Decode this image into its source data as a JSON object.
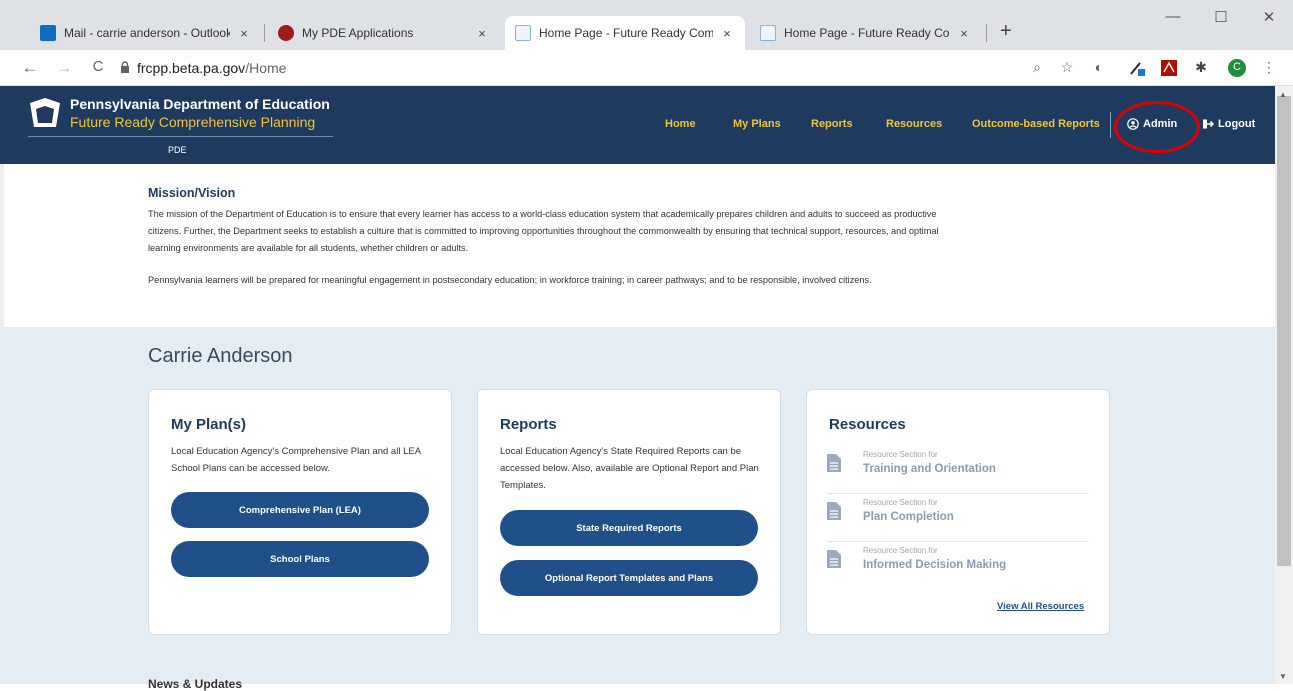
{
  "browser": {
    "tabs": [
      {
        "label": "Mail - carrie anderson - Outlook",
        "close": "×",
        "color": "#0f6cbd"
      },
      {
        "label": "My PDE Applications",
        "close": "×",
        "color": "#9b1c1c"
      },
      {
        "label": "Home Page - Future Ready Comp",
        "close": "×",
        "color": "#8ab4d8"
      },
      {
        "label": "Home Page - Future Ready Comp",
        "close": "×",
        "color": "#8ab4d8"
      }
    ],
    "new_tab": "+",
    "window_controls": {
      "minimize": "—",
      "maximize": "☐",
      "close": "✕"
    },
    "url_host": "frcpp.beta.pa.gov",
    "url_path": "/Home",
    "nav": {
      "back": "←",
      "forward": "→",
      "reload": "C"
    },
    "profile_initial": "C"
  },
  "header": {
    "org_name": "Pennsylvania Department of Education",
    "app_name": "Future Ready Comprehensive Planning",
    "sub_label": "PDE",
    "nav": [
      "Home",
      "My Plans",
      "Reports",
      "Resources",
      "Outcome-based Reports"
    ],
    "admin": "Admin",
    "logout": "Logout"
  },
  "mission": {
    "title": "Mission/Vision",
    "paragraph1": "The mission of the Department of Education is to ensure that every learner has access to a world-class education system that academically prepares children and adults to succeed as productive citizens. Further, the Department seeks to establish a culture that is committed to improving opportunities throughout the commonwealth by ensuring that technical support, resources, and optimal learning environments are available for all students, whether children or adults.",
    "paragraph2": "Pennsylvania learners will be prepared for meaningful engagement in postsecondary education; in workforce training; in career pathways; and to be responsible, involved citizens."
  },
  "user_name": "Carrie Anderson",
  "cards": {
    "plans": {
      "title": "My Plan(s)",
      "desc": "Local Education Agency's Comprehensive Plan and all LEA School Plans can be accessed below.",
      "button1": "Comprehensive Plan (LEA)",
      "button2": "School Plans"
    },
    "reports": {
      "title": "Reports",
      "desc": "Local Education Agency's State Required Reports can be accessed below. Also, available are Optional Report and Plan Templates.",
      "button1": "State Required Reports",
      "button2": "Optional Report Templates and Plans"
    },
    "resources": {
      "title": "Resources",
      "items": [
        {
          "small": "Resource Section for",
          "big": "Training and Orientation"
        },
        {
          "small": "Resource Section for",
          "big": "Plan Completion"
        },
        {
          "small": "Resource Section for",
          "big": "Informed Decision Making"
        }
      ],
      "view_all": "View All Resources"
    }
  },
  "news_title": "News & Updates"
}
